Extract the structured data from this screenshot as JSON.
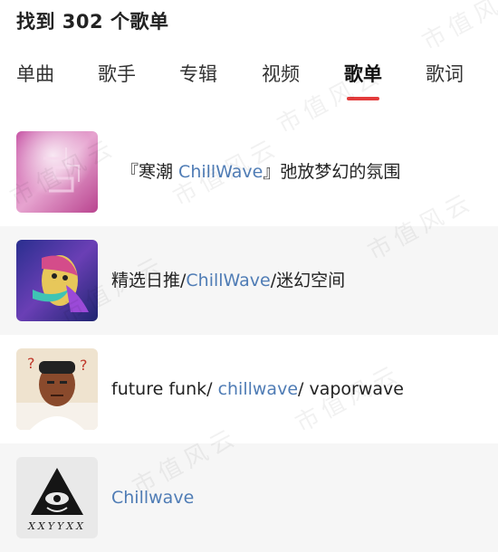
{
  "header": {
    "result_title": "找到 302 个歌单"
  },
  "tabs": [
    {
      "label": "单曲"
    },
    {
      "label": "歌手"
    },
    {
      "label": "专辑"
    },
    {
      "label": "视频"
    },
    {
      "label": "歌单"
    },
    {
      "label": "歌词"
    }
  ],
  "active_tab": "歌单",
  "playlists": [
    {
      "pre": "『寒潮 ",
      "highlight": "ChillWave",
      "post": "』弛放梦幻的氛围"
    },
    {
      "pre": "精选日推/",
      "highlight": "ChillWave",
      "post": "/迷幻空间"
    },
    {
      "pre": "future funk/ ",
      "highlight": "chillwave",
      "post": "/ vaporwave"
    },
    {
      "pre": "",
      "highlight": "Chillwave",
      "post": ""
    }
  ],
  "covers": {
    "cover4_text": "XXYYXX"
  },
  "watermark": "市值风云",
  "colors": {
    "highlight": "#4f7cb5",
    "tab_underline": "#e33b3b",
    "alt_row": "#f6f6f6"
  }
}
